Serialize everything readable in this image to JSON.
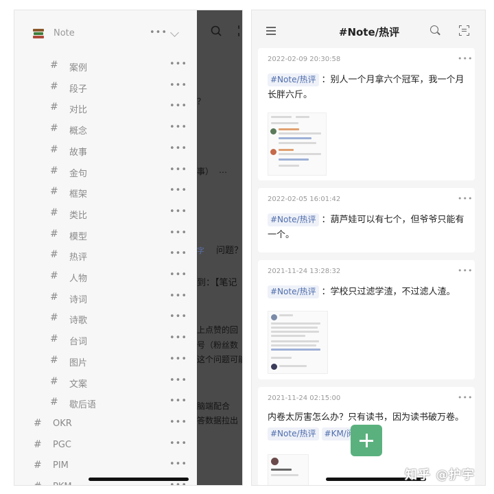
{
  "left_screen": {
    "notebook": {
      "title": "Note",
      "more": "•••"
    },
    "tags": [
      {
        "label": "案例",
        "more": "•••"
      },
      {
        "label": "段子",
        "more": "•••"
      },
      {
        "label": "对比",
        "more": "•••"
      },
      {
        "label": "概念",
        "more": "•••"
      },
      {
        "label": "故事",
        "more": "•••"
      },
      {
        "label": "金句",
        "more": "•••"
      },
      {
        "label": "框架",
        "more": "•••"
      },
      {
        "label": "类比",
        "more": "•••"
      },
      {
        "label": "模型",
        "more": "•••"
      },
      {
        "label": "热评",
        "more": "•••"
      },
      {
        "label": "人物",
        "more": "•••"
      },
      {
        "label": "诗词",
        "more": "•••"
      },
      {
        "label": "诗歌",
        "more": "•••"
      },
      {
        "label": "台词",
        "more": "•••"
      },
      {
        "label": "图片",
        "more": "•••"
      },
      {
        "label": "文案",
        "more": "•••"
      },
      {
        "label": "歇后语",
        "more": "•••"
      }
    ],
    "root_tags": [
      {
        "label": "OKR",
        "more": "•••"
      },
      {
        "label": "PGC",
        "more": "•••"
      },
      {
        "label": "PIM",
        "more": "•••"
      },
      {
        "label": "PKM",
        "more": "•••"
      }
    ],
    "hash_symbol": "#",
    "background_fragments": [
      "？",
      "事）",
      "…",
      "字",
      "问题？",
      "到：【笔记",
      "上点赞的回",
      "号（粉丝数",
      "这个问题可能",
      "脑端配合",
      "答数据拉出"
    ]
  },
  "right_screen": {
    "title": "#Note/热评",
    "cards": [
      {
        "timestamp": "2022-02-09 20:30:58",
        "tag": "#Note/热评",
        "text": "：别人一个月拿六个冠军，我一个月长胖六斤。",
        "more": "•••"
      },
      {
        "timestamp": "2022-02-05 16:01:42",
        "tag": "#Note/热评",
        "text": "：葫芦娃可以有七个，但爷爷只能有一个。",
        "more": "•••"
      },
      {
        "timestamp": "2021-11-24 13:28:32",
        "tag": "#Note/热评",
        "text": "：学校只过滤学渣，不过滤人渣。",
        "more": "•••"
      },
      {
        "timestamp": "2021-11-24 02:15:00",
        "text": "内卷太厉害怎么办？只有读书，因为读书破万卷。",
        "tags": [
          "#Note/热评",
          "#KM/阅读"
        ],
        "more": "•••"
      }
    ]
  },
  "watermark": "知乎 @护宇",
  "colors": {
    "tag_bg": "#eef1f8",
    "tag_text": "#4f6dad",
    "fab": "#5bb17e",
    "dim_overlay": "#4a4a4a"
  }
}
